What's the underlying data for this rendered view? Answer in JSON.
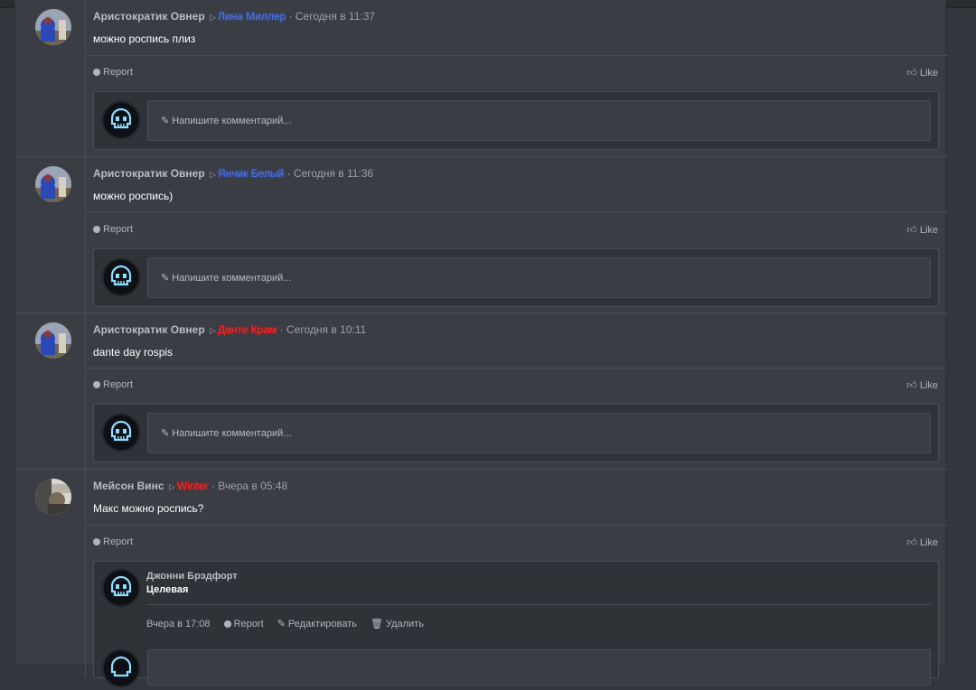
{
  "posts": [
    {
      "author": "Аристократик Овнер",
      "target": "Лина Миллер",
      "target_color": "blue",
      "time": "· Сегодня в 11:37",
      "text": "можно роспись плиз"
    },
    {
      "author": "Аристократик Овнер",
      "target": "Янчик Белый",
      "target_color": "blue",
      "time": "· Сегодня в 11:36",
      "text": "можно роспись)"
    },
    {
      "author": "Аристократик Овнер",
      "target": "Данте Крам",
      "target_color": "red",
      "time": "· Сегодня в 10:11",
      "text": "dante day rospis"
    },
    {
      "author": "Мейсон Винс",
      "target": "Winter",
      "target_color": "red",
      "time": "· Вчера в 05:48",
      "text": "Макс можно роспись?"
    }
  ],
  "actions": {
    "report": "Report",
    "like": "Like"
  },
  "comment_placeholder": "Напишите комментарий...",
  "reply": {
    "author": "Джонни Брэдфорт",
    "text": "Целевая",
    "time": "Вчера в 17:08",
    "report": "Report",
    "edit": "Редактировать",
    "delete": "Удалить"
  },
  "colors": {
    "background": "#33363c",
    "panel": "#3a3d44",
    "blue_name": "#4f74e8",
    "red_name": "#ff2a2a"
  },
  "icons": {
    "report": "info-circle-icon",
    "like": "thumbs-up-icon",
    "comment": "pencil-icon",
    "edit": "pencil-icon",
    "delete": "trash-icon",
    "arrow": "caret-right-icon"
  }
}
